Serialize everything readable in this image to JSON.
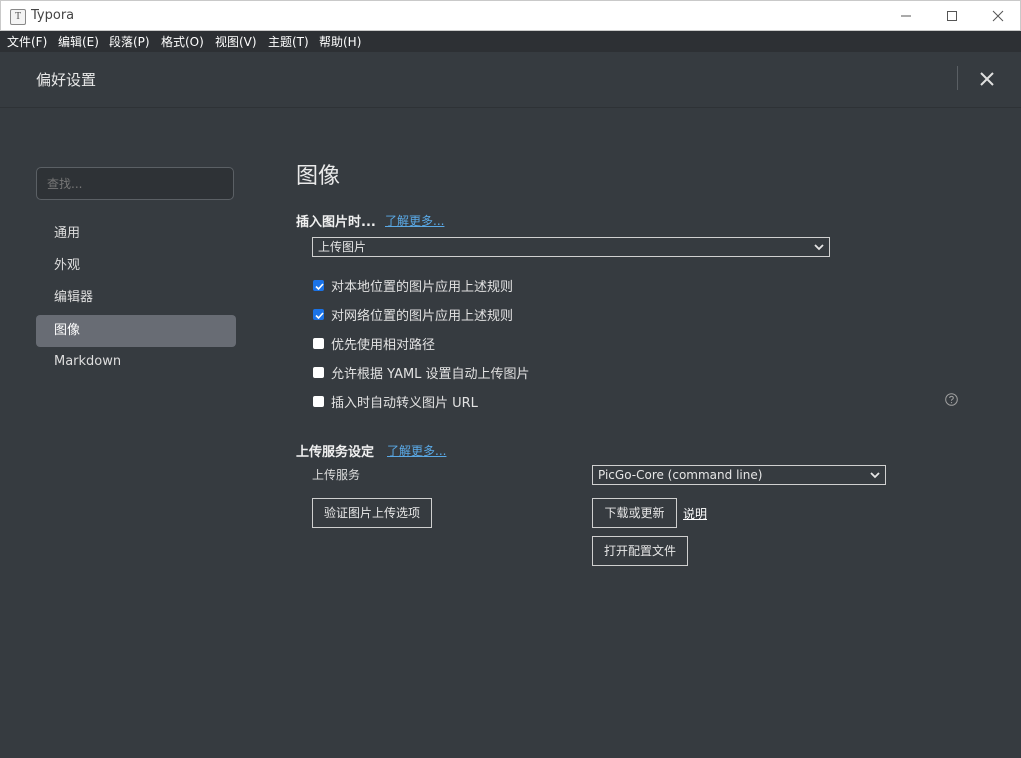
{
  "window": {
    "title": "Typora",
    "app_icon_letter": "T"
  },
  "menubar": {
    "items": [
      "文件(F)",
      "编辑(E)",
      "段落(P)",
      "格式(O)",
      "视图(V)",
      "主题(T)",
      "帮助(H)"
    ]
  },
  "prefs": {
    "title": "偏好设置"
  },
  "sidebar": {
    "search_placeholder": "查找...",
    "items": [
      {
        "label": "通用",
        "active": false
      },
      {
        "label": "外观",
        "active": false
      },
      {
        "label": "编辑器",
        "active": false
      },
      {
        "label": "图像",
        "active": true
      },
      {
        "label": "Markdown",
        "active": false
      }
    ]
  },
  "image_settings": {
    "section_title": "图像",
    "insert_label": "插入图片时...",
    "insert_learn_more": "了解更多...",
    "insert_action_selected": "上传图片",
    "options": [
      {
        "label": "对本地位置的图片应用上述规则",
        "checked": true
      },
      {
        "label": "对网络位置的图片应用上述规则",
        "checked": true
      },
      {
        "label": "优先使用相对路径",
        "checked": false
      },
      {
        "label": "允许根据 YAML 设置自动上传图片",
        "checked": false
      },
      {
        "label": "插入时自动转义图片 URL",
        "checked": false
      }
    ],
    "upload_label": "上传服务设定",
    "upload_learn_more": "了解更多...",
    "upload_service_label": "上传服务",
    "upload_service_selected": "PicGo-Core (command line)",
    "verify_button": "验证图片上传选项",
    "download_button": "下载或更新",
    "doc_link": "说明",
    "open_config_button": "打开配置文件"
  },
  "colors": {
    "background": "#363b40",
    "accent_link": "#5aa9e6",
    "active_nav": "#686c74",
    "checkbox_checked": "#1a73e8"
  }
}
